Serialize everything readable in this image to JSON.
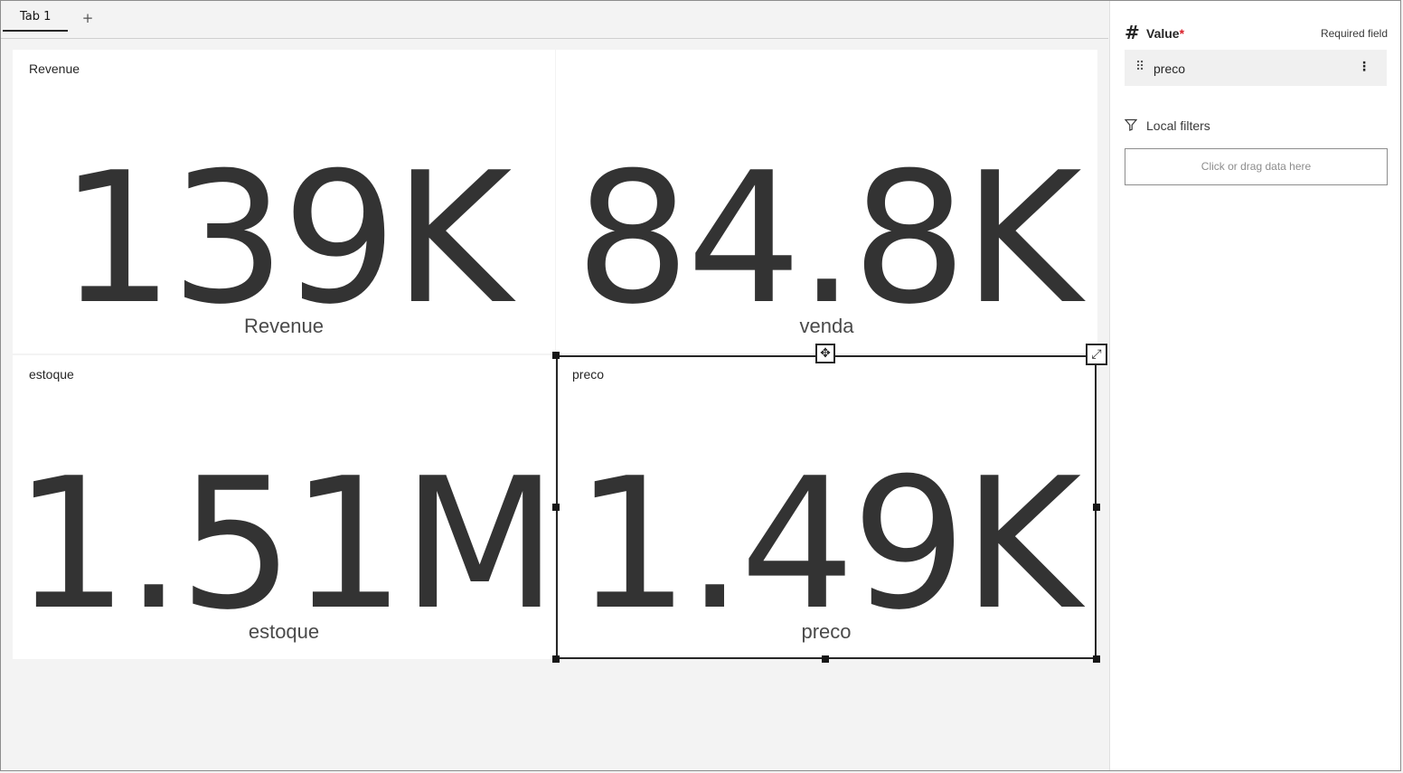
{
  "tabs": {
    "items": [
      {
        "label": "Tab 1"
      }
    ],
    "add_label": "+"
  },
  "tiles": [
    {
      "title": "Revenue",
      "value": "139K",
      "label": "Revenue"
    },
    {
      "title": "",
      "value": "84.8K",
      "label": "venda"
    },
    {
      "title": "estoque",
      "value": "1.51M",
      "label": "estoque"
    },
    {
      "title": "preco",
      "value": "1.49K",
      "label": "preco",
      "selected": true
    }
  ],
  "panel": {
    "value_section": {
      "title": "Value",
      "required_marker": "*",
      "required_text": "Required field",
      "field": "preco"
    },
    "filters_section": {
      "title": "Local filters",
      "dropzone": "Click or drag data here"
    }
  },
  "icons": {
    "value": "hash-icon",
    "drag": "drag-handle-icon",
    "overflow": "overflow-menu-icon",
    "filter": "filter-icon",
    "move": "move-icon",
    "expand": "expand-icon"
  },
  "colors": {
    "kpi_text": "#333333",
    "required": "#da1e28",
    "selection_border": "#262626"
  }
}
